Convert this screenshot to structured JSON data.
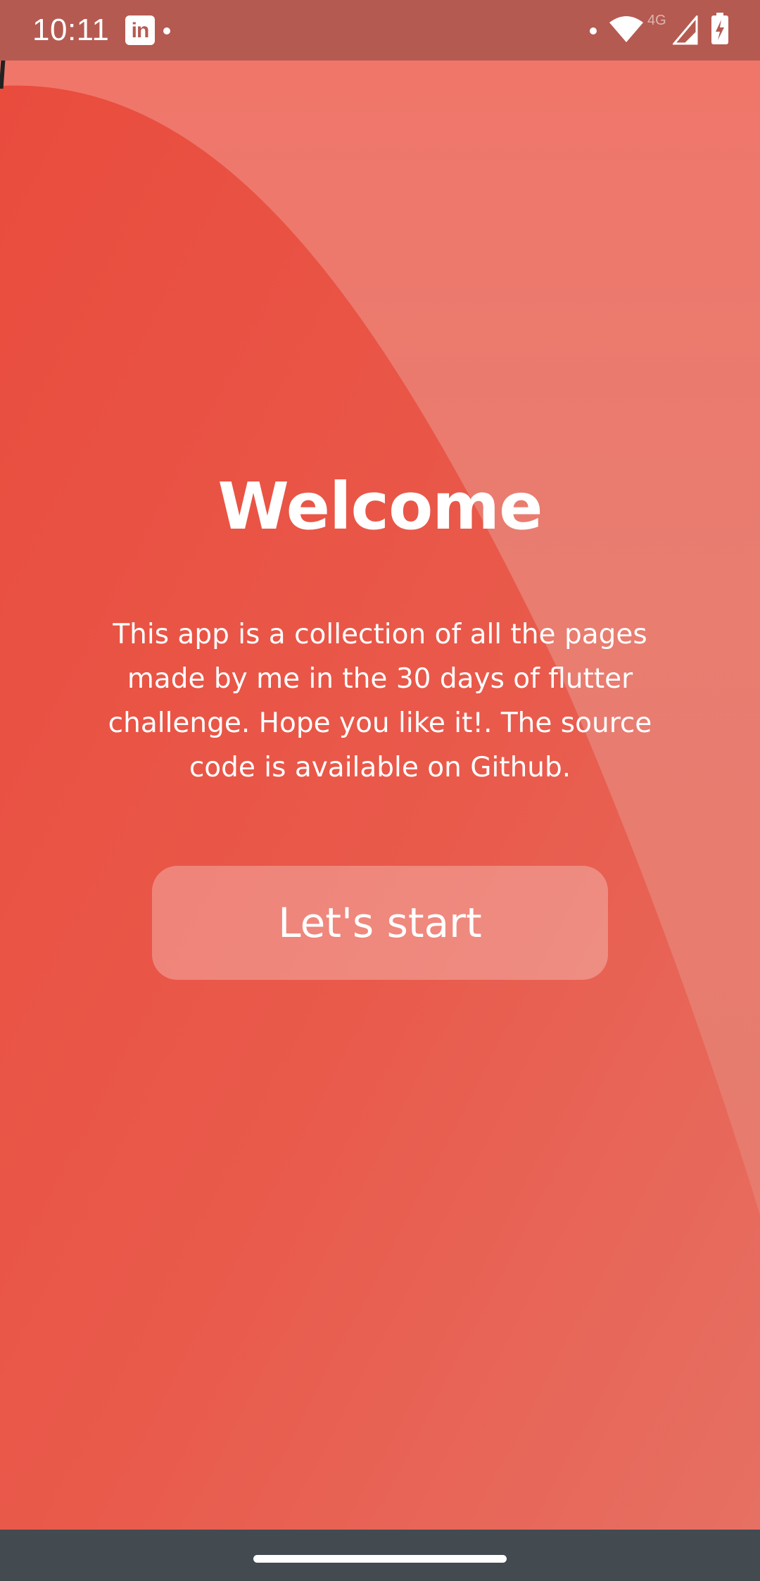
{
  "status_bar": {
    "time": "10:11",
    "network_label": "4G",
    "notification_app_icon": "linkedin-icon",
    "icons": [
      "linkedin-icon",
      "wifi-icon",
      "cell-signal-icon",
      "battery-charging-icon"
    ]
  },
  "welcome": {
    "title": "Welcome",
    "description": "This app is a collection of all the pages made by me in the 30 days of flutter challenge. Hope you like it!. The source code is available on Github.",
    "start_button_label": "Let's start"
  },
  "colors": {
    "status_bar_bg": "#b55a51",
    "background_light": "#f0766a",
    "wave_dark": "#e94c3d",
    "button_bg": "rgba(255,255,255,0.28)",
    "text": "#ffffff",
    "nav_bar_bg": "#434a50"
  }
}
